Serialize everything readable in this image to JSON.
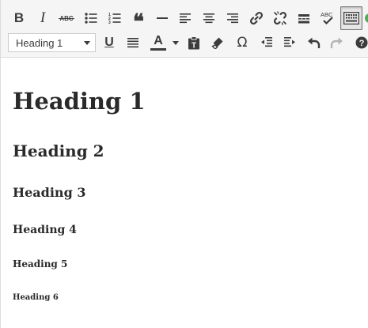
{
  "toolbar": {
    "row1": [
      {
        "name": "bold-icon",
        "label": "B"
      },
      {
        "name": "italic-icon",
        "label": "I"
      },
      {
        "name": "strikethrough-icon",
        "label": "ABC"
      },
      {
        "name": "bulleted-list-icon"
      },
      {
        "name": "numbered-list-icon"
      },
      {
        "name": "blockquote-icon",
        "label": "❝"
      },
      {
        "name": "horizontal-line-icon"
      },
      {
        "name": "align-left-icon"
      },
      {
        "name": "align-center-icon"
      },
      {
        "name": "align-right-icon"
      },
      {
        "name": "insert-link-icon"
      },
      {
        "name": "remove-link-icon"
      },
      {
        "name": "read-more-tag-icon"
      },
      {
        "name": "spellcheck-icon",
        "label": "ABC"
      },
      {
        "name": "toolbar-toggle-icon",
        "state": "active"
      },
      {
        "name": "distraction-free-icon"
      }
    ],
    "row2": {
      "format_select_value": "Heading 1",
      "underline_label": "U",
      "text_color_label": "A",
      "text_color_swatch": "#3c3c3c",
      "special_char_label": "Ω",
      "buttons": [
        {
          "name": "underline-icon"
        },
        {
          "name": "justify-icon"
        },
        {
          "name": "text-color-icon"
        },
        {
          "name": "paste-as-text-icon"
        },
        {
          "name": "clear-formatting-icon"
        },
        {
          "name": "special-character-icon"
        },
        {
          "name": "decrease-indent-icon"
        },
        {
          "name": "increase-indent-icon"
        },
        {
          "name": "undo-icon"
        },
        {
          "name": "redo-icon",
          "state": "disabled"
        },
        {
          "name": "help-icon"
        }
      ]
    }
  },
  "colors": {
    "toolbar_bg": "#f5f5f5",
    "icon": "#3c3c3c",
    "disabled_icon": "#b5b5b5",
    "accent_green": "#46b450"
  },
  "content": {
    "h1": "Heading 1",
    "h2": "Heading 2",
    "h3": "Heading 3",
    "h4": "Heading 4",
    "h5": "Heading 5",
    "h6": "Heading 6"
  }
}
